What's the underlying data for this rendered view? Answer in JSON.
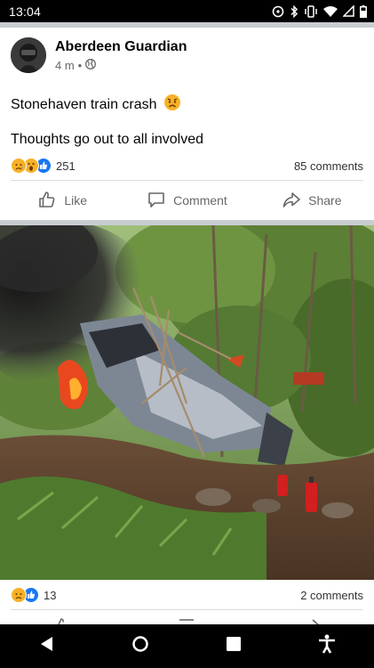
{
  "status_bar": {
    "time": "13:04"
  },
  "post1": {
    "page_name": "Aberdeen Guardian",
    "time_ago": "4 m",
    "dot": "•",
    "text_line1": "Stonehaven train crash",
    "text_line1_emoji": "😦",
    "text_line2": "Thoughts go out to all involved",
    "reaction_count": "251",
    "comment_count": "85 comments",
    "actions": {
      "like": "Like",
      "comment": "Comment",
      "share": "Share"
    }
  },
  "post2": {
    "reaction_count": "13",
    "comment_count": "2 comments"
  },
  "colors": {
    "facebook_blue": "#1877f2",
    "reaction_yellow": "#f7b125",
    "secondary_text": "#65676b"
  },
  "icons": {
    "status": [
      "location-icon",
      "bluetooth-icon",
      "vibrate-icon",
      "wifi-icon",
      "signal-icon",
      "battery-icon"
    ],
    "nav": [
      "back-icon",
      "home-icon",
      "recents-icon",
      "accessibility-icon"
    ]
  }
}
